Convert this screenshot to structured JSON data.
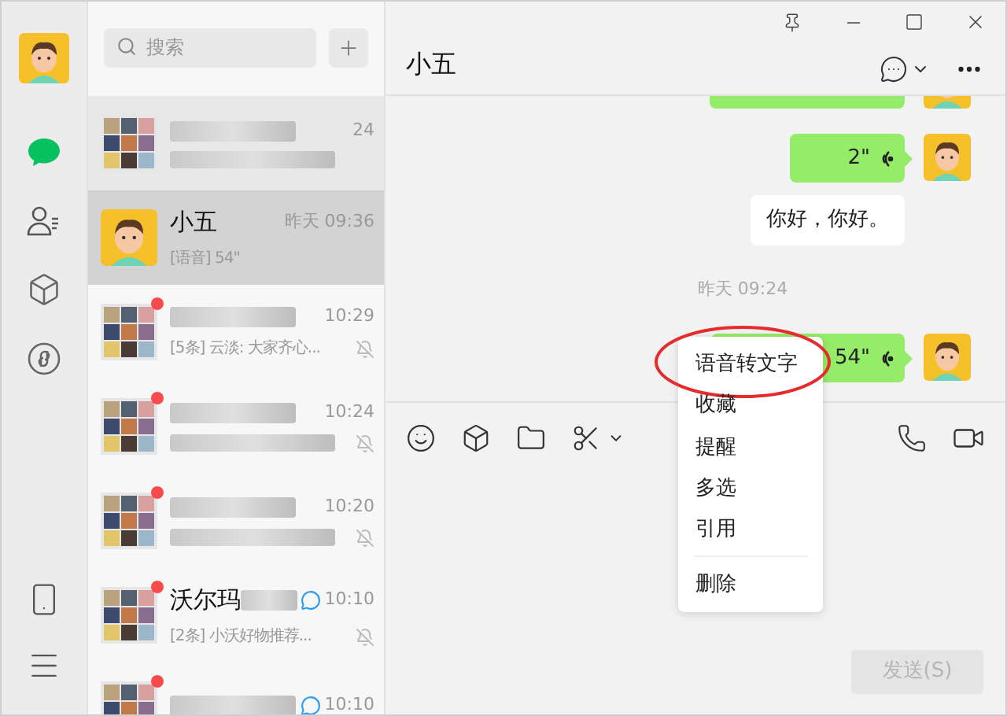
{
  "nav": {
    "items": [
      {
        "kind": "avatar",
        "selected": false
      },
      {
        "kind": "chats",
        "selected": true
      },
      {
        "kind": "contacts",
        "selected": false
      },
      {
        "kind": "cube",
        "selected": false
      },
      {
        "kind": "spiral",
        "selected": false
      }
    ],
    "bottom": [
      {
        "kind": "phone"
      },
      {
        "kind": "menu"
      }
    ]
  },
  "chat_list": {
    "search": {
      "placeholder": "搜索"
    },
    "items": [
      {
        "kind": "group",
        "name_blurred": true,
        "preview_blurred": true,
        "time": "24",
        "pinned": true,
        "selected": false,
        "unread": false,
        "muted": false,
        "ai_tag": false
      },
      {
        "kind": "person",
        "name": "小五",
        "name_blurred": false,
        "preview": "[语音] 54\"",
        "preview_blurred": false,
        "time": "昨天 09:36",
        "pinned": false,
        "selected": true,
        "unread": false,
        "muted": false,
        "ai_tag": false
      },
      {
        "kind": "group",
        "name_blurred": true,
        "preview": "[5条] 云淡: 大家齐心...",
        "preview_blurred": false,
        "time": "10:29",
        "pinned": false,
        "selected": false,
        "unread": true,
        "muted": true,
        "ai_tag": false
      },
      {
        "kind": "group",
        "name_blurred": true,
        "preview_blurred": true,
        "time": "10:24",
        "pinned": false,
        "selected": false,
        "unread": true,
        "muted": true,
        "ai_tag": false
      },
      {
        "kind": "group",
        "name_blurred": true,
        "preview_blurred": true,
        "time": "10:20",
        "pinned": false,
        "selected": false,
        "unread": true,
        "muted": true,
        "ai_tag": false
      },
      {
        "kind": "group",
        "name": "沃尔玛",
        "name_blurred": true,
        "preview": "[2条] 小沃好物推荐...",
        "preview_blurred": false,
        "time": "10:10",
        "pinned": false,
        "selected": false,
        "unread": true,
        "muted": true,
        "ai_tag": true
      },
      {
        "kind": "group",
        "name_blurred": true,
        "preview_blurred": false,
        "time": "10:10",
        "pinned": false,
        "selected": false,
        "unread": true,
        "muted": false,
        "ai_tag": true
      }
    ]
  },
  "chat": {
    "title": "小五",
    "messages": [
      {
        "kind": "cut"
      },
      {
        "kind": "voice",
        "text": "2\""
      },
      {
        "kind": "transcript",
        "text": "你好，你好。"
      },
      {
        "kind": "time",
        "text": "昨天 09:24"
      },
      {
        "kind": "voice",
        "text": "54\""
      }
    ],
    "context_menu": [
      {
        "label": "语音转文字",
        "divider_before": false,
        "highlighted": true
      },
      {
        "label": "收藏",
        "divider_before": false,
        "highlighted": false
      },
      {
        "label": "提醒",
        "divider_before": false,
        "highlighted": false
      },
      {
        "label": "多选",
        "divider_before": false,
        "highlighted": false
      },
      {
        "label": "引用",
        "divider_before": false,
        "highlighted": false
      },
      {
        "label": "删除",
        "divider_before": true,
        "highlighted": false
      }
    ],
    "send_button": {
      "label": "发送(S)",
      "disabled": true
    }
  }
}
